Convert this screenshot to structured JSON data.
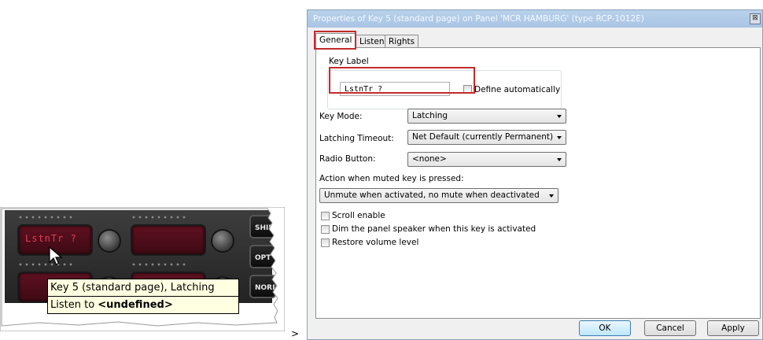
{
  "panel": {
    "key_lcd_text": "LstnTr ?",
    "side_buttons": [
      "SHIF",
      "OPT",
      "NORI"
    ],
    "tooltip": {
      "line1": "Key 5 (standard page), Latching",
      "line2_prefix": "Listen to ",
      "line2_value": "<undefined>"
    },
    "separator": ">"
  },
  "dialog": {
    "title": "Properties of Key 5 (standard page) on Panel 'MCR HAMBURG' (type RCP-1012E)",
    "close_label": "⊠",
    "tabs": [
      "General",
      "Listen",
      "Rights"
    ],
    "active_tab": "General",
    "key_label": {
      "group_title": "Key Label",
      "value": "LstnTr ?",
      "define_auto_label": "Define automatically",
      "define_auto_checked": false
    },
    "fields": {
      "key_mode_label": "Key Mode:",
      "key_mode_value": "Latching",
      "latching_timeout_label": "Latching Timeout:",
      "latching_timeout_value": "Net Default (currently Permanent)",
      "radio_button_label": "Radio Button:",
      "radio_button_value": "<none>",
      "muted_action_label": "Action when muted key is pressed:",
      "muted_action_value": "Unmute when activated, no mute when deactivated"
    },
    "checkboxes": [
      {
        "label": "Scroll enable",
        "checked": false
      },
      {
        "label": "Dim the panel speaker when this key is activated",
        "checked": false
      },
      {
        "label": "Restore volume level",
        "checked": false
      }
    ],
    "buttons": {
      "ok": "OK",
      "cancel": "Cancel",
      "apply": "Apply"
    }
  },
  "colors": {
    "highlight_box": "#c42b2b",
    "lcd_text": "#e23a55",
    "tooltip_bg": "#ffffe1"
  }
}
